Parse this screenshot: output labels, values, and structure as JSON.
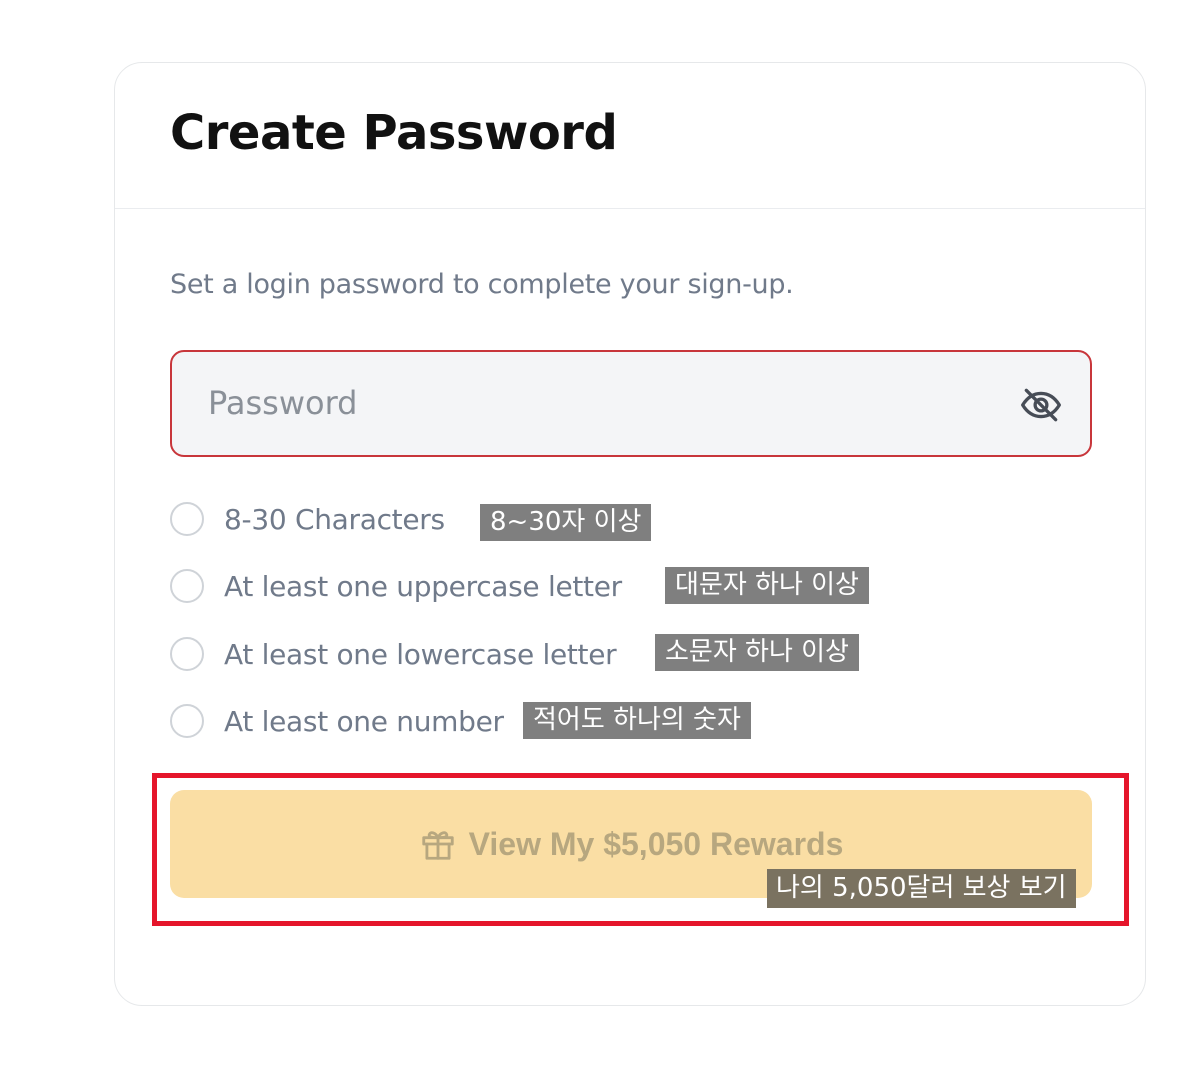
{
  "title": "Create Password",
  "subtitle": "Set a login password to complete your sign-up.",
  "password": {
    "placeholder": "Password",
    "value": "",
    "toggle_icon": "eye-off-icon"
  },
  "rules": [
    {
      "label": "8-30 Characters",
      "annotation": "8~30자 이상"
    },
    {
      "label": "At least one uppercase letter",
      "annotation": "대문자 하나 이상"
    },
    {
      "label": "At least one lowercase letter",
      "annotation": "소문자 하나 이상"
    },
    {
      "label": "At least one number",
      "annotation": "적어도 하나의 숫자"
    }
  ],
  "cta": {
    "label": "View My $5,050 Rewards",
    "icon": "gift-icon",
    "annotation": "나의 5,050달러 보상 보기"
  },
  "colors": {
    "error_border": "#c8363b",
    "cta_background": "#fadea4",
    "highlight": "#e5152b"
  }
}
